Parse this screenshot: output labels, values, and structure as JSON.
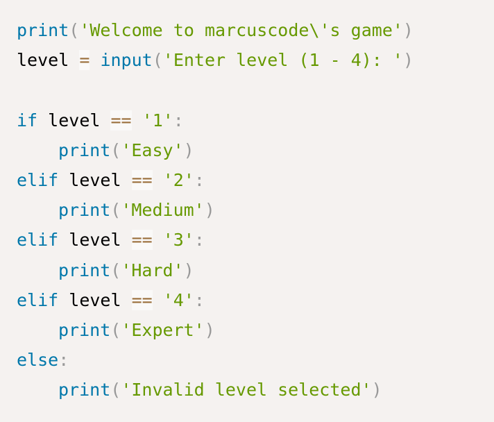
{
  "lines": [
    {
      "indent": false,
      "tokens": [
        {
          "t": "fn",
          "v": "print"
        },
        {
          "t": "punct",
          "v": "("
        },
        {
          "t": "str",
          "v": "'Welcome to marcuscode\\'s game'"
        },
        {
          "t": "punct",
          "v": ")"
        }
      ]
    },
    {
      "indent": false,
      "tokens": [
        {
          "t": "var",
          "v": "level "
        },
        {
          "t": "op",
          "v": "="
        },
        {
          "t": "var",
          "v": " "
        },
        {
          "t": "fn",
          "v": "input"
        },
        {
          "t": "punct",
          "v": "("
        },
        {
          "t": "str",
          "v": "'Enter level (1 - 4): '"
        },
        {
          "t": "punct",
          "v": ")"
        }
      ]
    },
    {
      "indent": false,
      "tokens": []
    },
    {
      "indent": false,
      "tokens": [
        {
          "t": "kw",
          "v": "if"
        },
        {
          "t": "var",
          "v": " level "
        },
        {
          "t": "op",
          "v": "=="
        },
        {
          "t": "var",
          "v": " "
        },
        {
          "t": "str",
          "v": "'1'"
        },
        {
          "t": "punct",
          "v": ":"
        }
      ]
    },
    {
      "indent": true,
      "tokens": [
        {
          "t": "fn",
          "v": "print"
        },
        {
          "t": "punct",
          "v": "("
        },
        {
          "t": "str",
          "v": "'Easy'"
        },
        {
          "t": "punct",
          "v": ")"
        }
      ]
    },
    {
      "indent": false,
      "tokens": [
        {
          "t": "kw",
          "v": "elif"
        },
        {
          "t": "var",
          "v": " level "
        },
        {
          "t": "op",
          "v": "=="
        },
        {
          "t": "var",
          "v": " "
        },
        {
          "t": "str",
          "v": "'2'"
        },
        {
          "t": "punct",
          "v": ":"
        }
      ]
    },
    {
      "indent": true,
      "tokens": [
        {
          "t": "fn",
          "v": "print"
        },
        {
          "t": "punct",
          "v": "("
        },
        {
          "t": "str",
          "v": "'Medium'"
        },
        {
          "t": "punct",
          "v": ")"
        }
      ]
    },
    {
      "indent": false,
      "tokens": [
        {
          "t": "kw",
          "v": "elif"
        },
        {
          "t": "var",
          "v": " level "
        },
        {
          "t": "op",
          "v": "=="
        },
        {
          "t": "var",
          "v": " "
        },
        {
          "t": "str",
          "v": "'3'"
        },
        {
          "t": "punct",
          "v": ":"
        }
      ]
    },
    {
      "indent": true,
      "tokens": [
        {
          "t": "fn",
          "v": "print"
        },
        {
          "t": "punct",
          "v": "("
        },
        {
          "t": "str",
          "v": "'Hard'"
        },
        {
          "t": "punct",
          "v": ")"
        }
      ]
    },
    {
      "indent": false,
      "tokens": [
        {
          "t": "kw",
          "v": "elif"
        },
        {
          "t": "var",
          "v": " level "
        },
        {
          "t": "op",
          "v": "=="
        },
        {
          "t": "var",
          "v": " "
        },
        {
          "t": "str",
          "v": "'4'"
        },
        {
          "t": "punct",
          "v": ":"
        }
      ]
    },
    {
      "indent": true,
      "tokens": [
        {
          "t": "fn",
          "v": "print"
        },
        {
          "t": "punct",
          "v": "("
        },
        {
          "t": "str",
          "v": "'Expert'"
        },
        {
          "t": "punct",
          "v": ")"
        }
      ]
    },
    {
      "indent": false,
      "tokens": [
        {
          "t": "kw",
          "v": "else"
        },
        {
          "t": "punct",
          "v": ":"
        }
      ]
    },
    {
      "indent": true,
      "tokens": [
        {
          "t": "fn",
          "v": "print"
        },
        {
          "t": "punct",
          "v": "("
        },
        {
          "t": "str",
          "v": "'Invalid level selected'"
        },
        {
          "t": "punct",
          "v": ")"
        }
      ]
    }
  ],
  "colors": {
    "background": "#f5f2f0",
    "keyword": "#0077aa",
    "function": "#0077aa",
    "string": "#669900",
    "punctuation": "#999999",
    "operator": "#9a6e3a",
    "text": "#000000"
  }
}
